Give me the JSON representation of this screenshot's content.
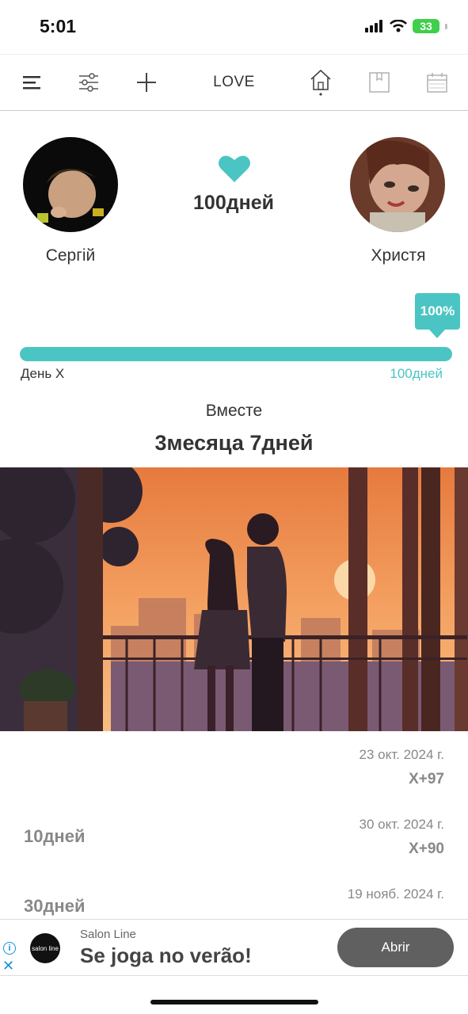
{
  "status_bar": {
    "time": "5:01",
    "battery": "33"
  },
  "toolbar": {
    "title": "LOVE"
  },
  "couple": {
    "left_name": "Сергій",
    "right_name": "Христя",
    "days": "100дней"
  },
  "progress": {
    "percent_label": "100%",
    "fraction": 1.0,
    "start_label": "День X",
    "end_label": "100дней"
  },
  "together": {
    "label": "Вместе",
    "value": "3месяца 7дней"
  },
  "colors": {
    "accent": "#4bc5c3",
    "sky": "#f08a4b"
  },
  "milestones": [
    {
      "title": "",
      "date": "23 окт. 2024 г.",
      "x": "X+97"
    },
    {
      "title": "10дней",
      "date": "30 окт. 2024 г.",
      "x": "X+90"
    },
    {
      "title": "30дней",
      "date": "19 нояб. 2024 г.",
      "x": ""
    }
  ],
  "ad": {
    "logo_text": "salon line",
    "brand": "Salon Line",
    "headline": "Se joga no verão!",
    "cta": "Abrir",
    "info_icon": "i",
    "close_icon": "✕"
  }
}
